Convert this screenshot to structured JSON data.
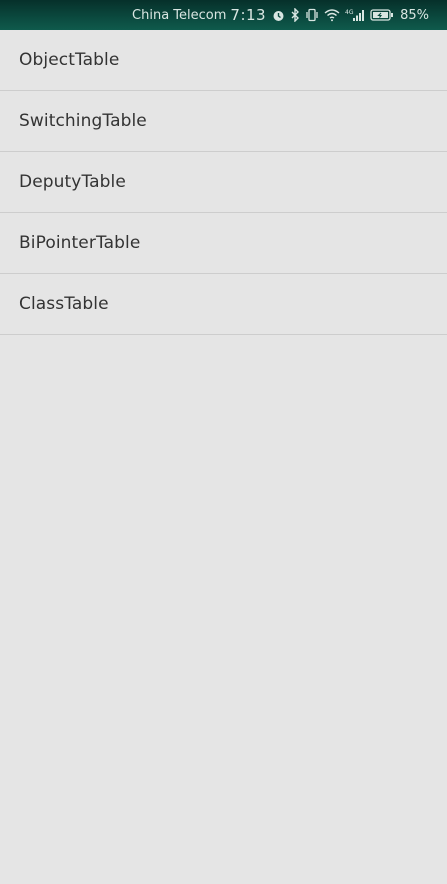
{
  "status_bar": {
    "carrier": "China Telecom",
    "time": "7:13",
    "network_label": "4G",
    "battery": "85%",
    "icons": [
      "alarm-icon",
      "bluetooth-icon",
      "vibrate-icon",
      "wifi-icon",
      "signal-icon",
      "battery-icon"
    ],
    "background_color": "#0b4a3f"
  },
  "list": {
    "items": [
      {
        "label": "ObjectTable"
      },
      {
        "label": "SwitchingTable"
      },
      {
        "label": "DeputyTable"
      },
      {
        "label": "BiPointerTable"
      },
      {
        "label": "ClassTable"
      }
    ]
  }
}
